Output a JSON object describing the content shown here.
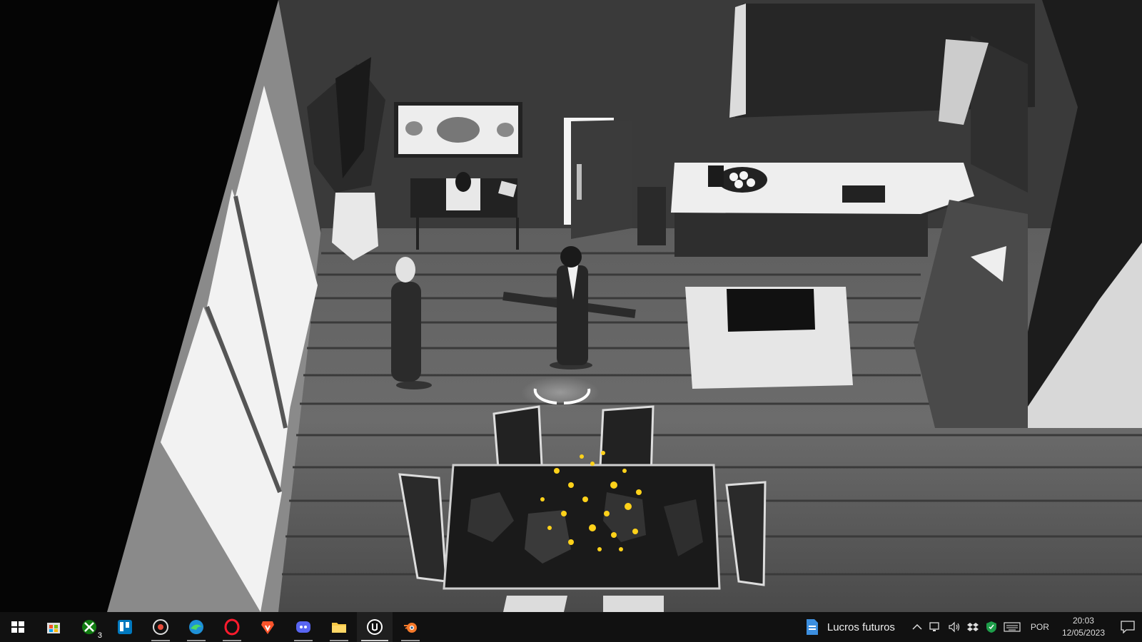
{
  "scene": {
    "description_icon": "game-viewport"
  },
  "taskbar": {
    "apps": [
      {
        "name": "start-button",
        "icon": "windows-icon"
      },
      {
        "name": "microsoft-store-button",
        "icon": "store-icon"
      },
      {
        "name": "xbox-button",
        "icon": "xbox-icon",
        "badge": "3"
      },
      {
        "name": "trello-button",
        "icon": "trello-icon"
      },
      {
        "name": "davinci-button",
        "icon": "disc-icon"
      },
      {
        "name": "edge-button",
        "icon": "edge-icon"
      },
      {
        "name": "opera-button",
        "icon": "opera-icon"
      },
      {
        "name": "brave-button",
        "icon": "brave-icon"
      },
      {
        "name": "discord-button",
        "icon": "discord-icon"
      },
      {
        "name": "file-explorer-button",
        "icon": "folder-icon"
      },
      {
        "name": "unreal-engine-button",
        "icon": "unreal-icon"
      },
      {
        "name": "blender-button",
        "icon": "blender-icon"
      }
    ],
    "tray": {
      "app_label": "Lucros futuros",
      "language": "POR",
      "time": "20:03",
      "date": "12/05/2023"
    }
  }
}
